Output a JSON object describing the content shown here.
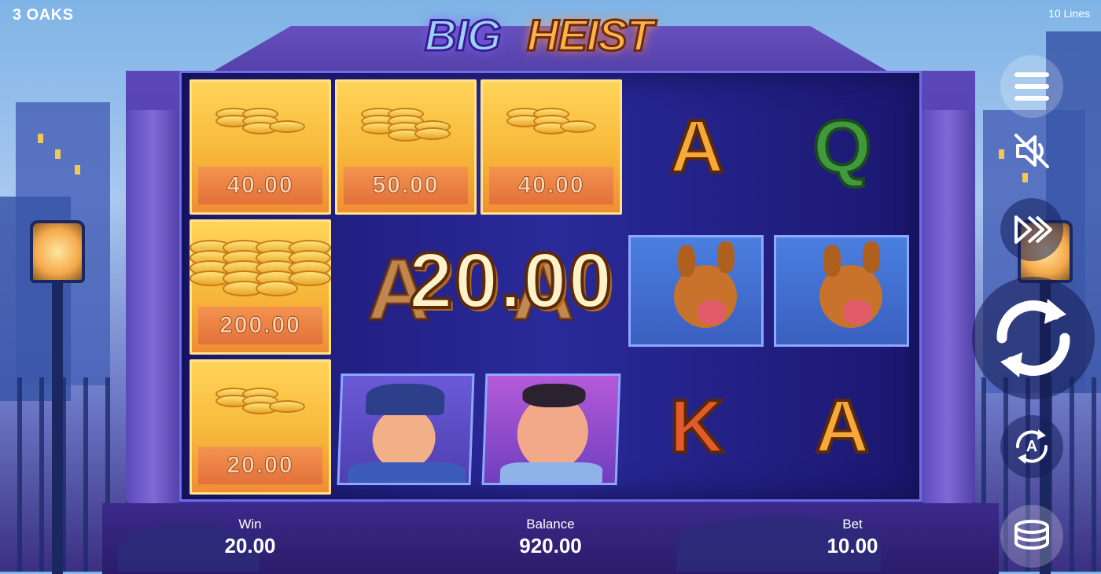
{
  "header": {
    "brand": "3 OAKS",
    "lines": "10 Lines",
    "logo_part1": "BIG",
    "logo_part2": "HEIST"
  },
  "reels": {
    "money_values": {
      "r1c1": "40.00",
      "r1c2": "50.00",
      "r1c3": "40.00",
      "r2c1": "200.00",
      "r3c1": "20.00"
    },
    "symbols": {
      "r1c4": "A",
      "r1c5": "Q",
      "r2c2": "A",
      "r2c3": "A",
      "r3c4": "K",
      "r3c5": "A"
    },
    "win_overlay": "20.00"
  },
  "footer": {
    "win_label": "Win",
    "win_value": "20.00",
    "balance_label": "Balance",
    "balance_value": "920.00",
    "bet_label": "Bet",
    "bet_value": "10.00"
  },
  "controls": {
    "autoplay_letter": "A"
  },
  "colors": {
    "money_tile": "#f7b83a",
    "reel_bg": "#2a2a9a",
    "frame": "#6f6ae8",
    "text": "#ffffff"
  }
}
